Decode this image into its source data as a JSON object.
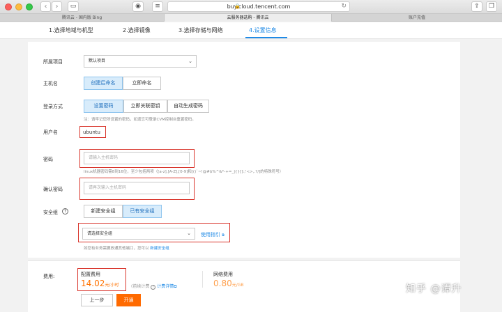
{
  "browser": {
    "url": "buy.cloud.tencent.com",
    "tabs": [
      "腾讯云 - 国内版 Bing",
      "云服务器选购 - 腾讯云",
      "账户充值"
    ]
  },
  "steps": [
    "1.选择地域与机型",
    "2.选择镜像",
    "3.选择存储与网络",
    "4.设置信息"
  ],
  "form": {
    "project_label": "所属项目",
    "project_value": "默认项目",
    "hostname_label": "主机名",
    "hostname_options": [
      "创建后命名",
      "立即命名"
    ],
    "login_label": "登录方式",
    "login_options": [
      "设置密码",
      "立即关联密钥",
      "自动生成密码"
    ],
    "login_hint": "注：请牢记您所设置的密码，如遗忘可登录CVM控制台重置密码。",
    "username_label": "用户名",
    "username_value": "ubuntu",
    "password_label": "密码",
    "password_placeholder": "请输入主机密码",
    "password_hint": "linux机器密码需8到16位，至少包括两项（[a-z],[A-Z],[0-9]和[()`~!@#$%^&*-+=_|{}[]:;'<>,.?/]的特殊符号）",
    "confirm_label": "确认密码",
    "confirm_placeholder": "请再次输入主机密码",
    "security_label": "安全组",
    "security_help": "?",
    "security_options": [
      "新建安全组",
      "已有安全组"
    ],
    "security_select": "请选择安全组",
    "security_guide": "使用指引",
    "security_hint": "如您有业务需要放通其他端口，您可以",
    "security_hint_link": "新建安全组"
  },
  "footer": {
    "fee_label": "费用:",
    "config_fee_label": "配置费用",
    "config_fee_value": "14.02",
    "config_fee_unit": "元/小时",
    "billing_note": "(前续计费",
    "billing_detail": "计费详情",
    "network_fee_label": "网络费用",
    "network_fee_value": "0.80",
    "network_fee_unit": "元/GB",
    "prev_button": "上一步",
    "go_button": "开通"
  },
  "watermark": "知乎 @谭升"
}
